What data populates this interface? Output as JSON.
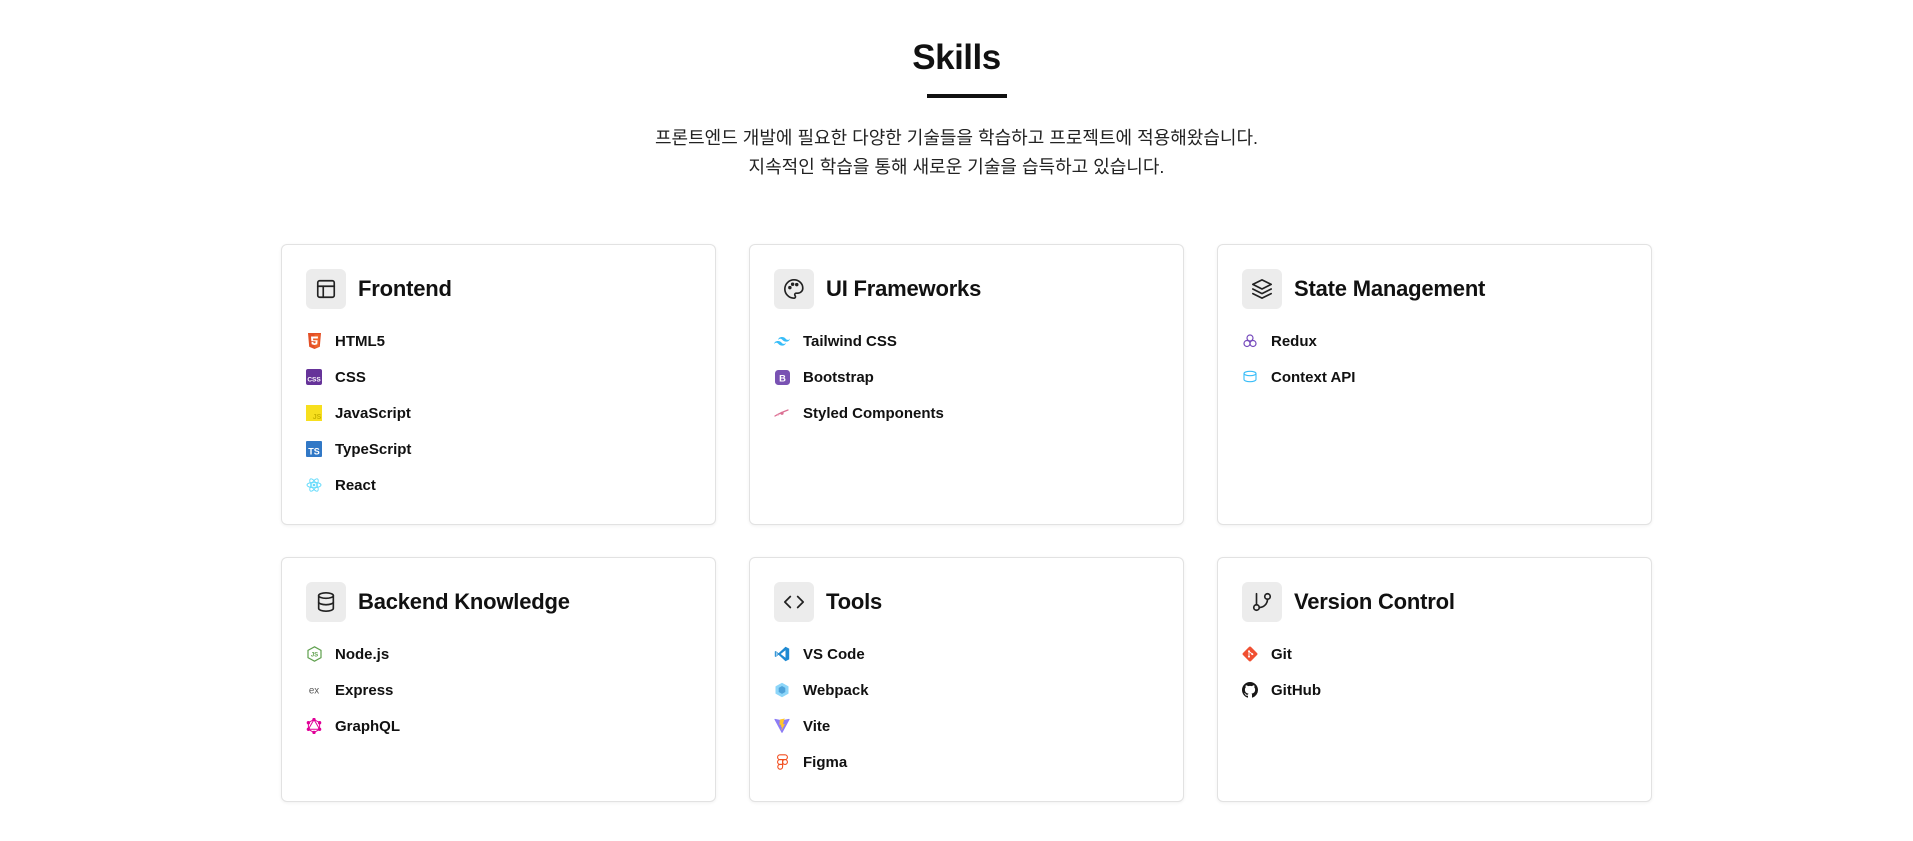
{
  "section": {
    "title": "Skills",
    "description_line1": "프론트엔드 개발에 필요한 다양한 기술들을 학습하고 프로젝트에 적용해왔습니다.",
    "description_line2": "지속적인 학습을 통해 새로운 기술을 습득하고 있습니다."
  },
  "cards": [
    {
      "title": "Frontend",
      "icon": "layout-icon",
      "skills": [
        {
          "label": "HTML5",
          "icon": "html5-icon",
          "color": "#e34f26"
        },
        {
          "label": "CSS",
          "icon": "css-icon",
          "color": "#663399"
        },
        {
          "label": "JavaScript",
          "icon": "javascript-icon",
          "color": "#f7df1e"
        },
        {
          "label": "TypeScript",
          "icon": "typescript-icon",
          "color": "#3178c6"
        },
        {
          "label": "React",
          "icon": "react-icon",
          "color": "#61dafb"
        }
      ]
    },
    {
      "title": "UI Frameworks",
      "icon": "palette-icon",
      "skills": [
        {
          "label": "Tailwind CSS",
          "icon": "tailwind-icon",
          "color": "#38bdf8"
        },
        {
          "label": "Bootstrap",
          "icon": "bootstrap-icon",
          "color": "#7952b3"
        },
        {
          "label": "Styled Components",
          "icon": "styled-components-icon",
          "color": "#db7093"
        }
      ]
    },
    {
      "title": "State Management",
      "icon": "layers-icon",
      "skills": [
        {
          "label": "Redux",
          "icon": "redux-icon",
          "color": "#764abc"
        },
        {
          "label": "Context API",
          "icon": "context-api-icon",
          "color": "#61dafb"
        }
      ]
    },
    {
      "title": "Backend Knowledge",
      "icon": "database-icon",
      "skills": [
        {
          "label": "Node.js",
          "icon": "nodejs-icon",
          "color": "#5fa04e"
        },
        {
          "label": "Express",
          "icon": "express-icon",
          "color": "#555555"
        },
        {
          "label": "GraphQL",
          "icon": "graphql-icon",
          "color": "#e10098"
        }
      ]
    },
    {
      "title": "Tools",
      "icon": "code-icon",
      "skills": [
        {
          "label": "VS Code",
          "icon": "vscode-icon",
          "color": "#007acc"
        },
        {
          "label": "Webpack",
          "icon": "webpack-icon",
          "color": "#8dd6f9"
        },
        {
          "label": "Vite",
          "icon": "vite-icon",
          "color": "#646cff"
        },
        {
          "label": "Figma",
          "icon": "figma-icon",
          "color": "#f24e1e"
        }
      ]
    },
    {
      "title": "Version Control",
      "icon": "git-branch-icon",
      "skills": [
        {
          "label": "Git",
          "icon": "git-icon",
          "color": "#f05032"
        },
        {
          "label": "GitHub",
          "icon": "github-icon",
          "color": "#181717"
        }
      ]
    }
  ]
}
